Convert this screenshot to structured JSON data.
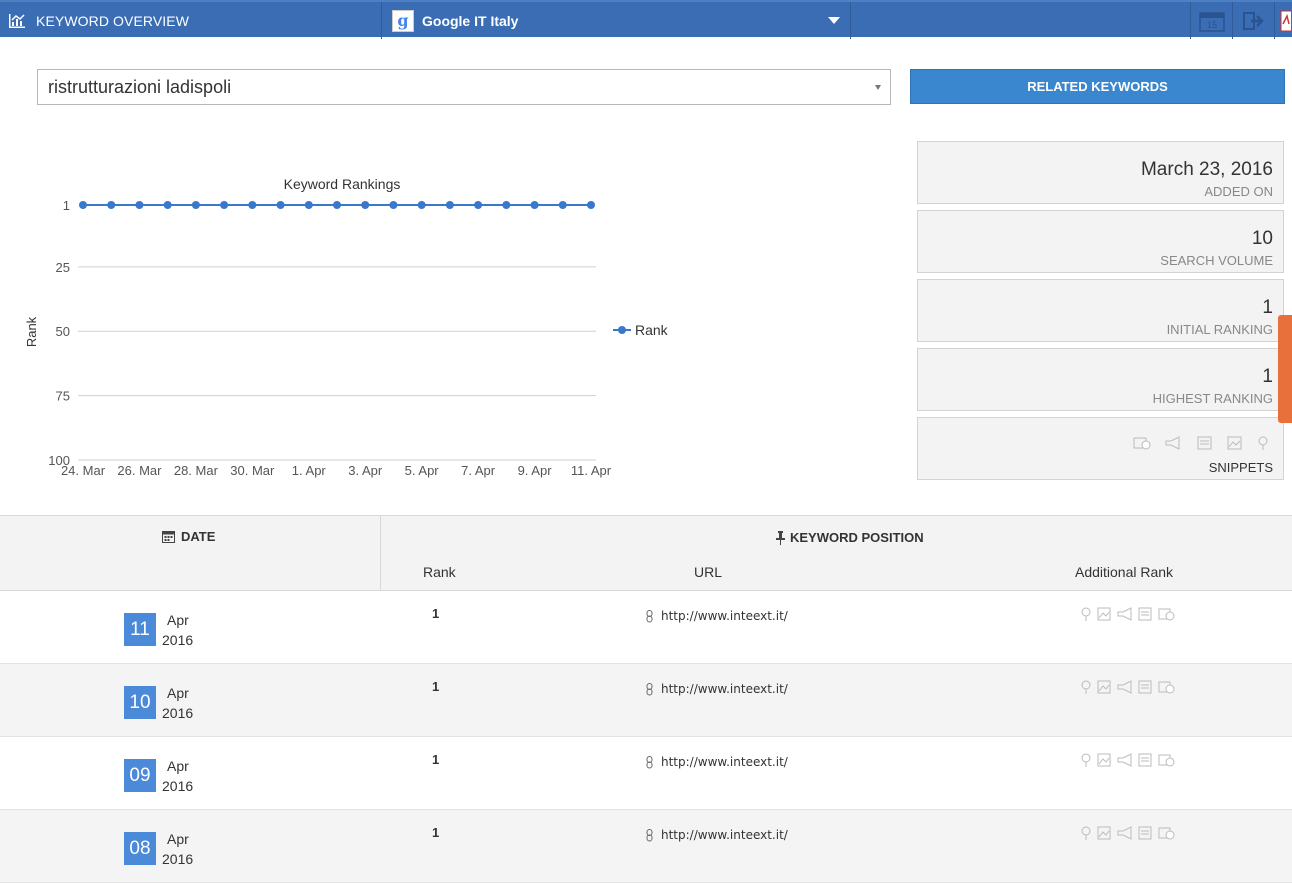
{
  "header": {
    "title": "KEYWORD OVERVIEW",
    "engine": "Google IT Italy",
    "google_letter": "g"
  },
  "search": {
    "value": "ristrutturazioni ladispoli",
    "related_button": "RELATED KEYWORDS"
  },
  "cards": [
    {
      "value": "March 23, 2016",
      "label": "ADDED ON"
    },
    {
      "value": "10",
      "label": "SEARCH VOLUME"
    },
    {
      "value": "1",
      "label": "INITIAL RANKING"
    },
    {
      "value": "1",
      "label": "HIGHEST RANKING"
    },
    {
      "label": "SNIPPETS"
    }
  ],
  "chart_data": {
    "type": "line",
    "title": "Keyword Rankings",
    "ylabel": "Rank",
    "xlabel": "",
    "y_reversed": true,
    "ylim": [
      1,
      100
    ],
    "yticks": [
      1,
      25,
      50,
      75,
      100
    ],
    "xticks": [
      "24. Mar",
      "26. Mar",
      "28. Mar",
      "30. Mar",
      "1. Apr",
      "3. Apr",
      "5. Apr",
      "7. Apr",
      "9. Apr",
      "11. Apr"
    ],
    "x": [
      "24. Mar",
      "25. Mar",
      "26. Mar",
      "27. Mar",
      "28. Mar",
      "29. Mar",
      "30. Mar",
      "31. Mar",
      "1. Apr",
      "2. Apr",
      "3. Apr",
      "4. Apr",
      "5. Apr",
      "6. Apr",
      "7. Apr",
      "8. Apr",
      "9. Apr",
      "10. Apr",
      "11. Apr"
    ],
    "series": [
      {
        "name": "Rank",
        "color": "#3a78cc",
        "values": [
          1,
          1,
          1,
          1,
          1,
          1,
          1,
          1,
          1,
          1,
          1,
          1,
          1,
          1,
          1,
          1,
          1,
          1,
          1
        ]
      }
    ],
    "grid": true,
    "legend": "right"
  },
  "table": {
    "date_header": "DATE",
    "position_header": "KEYWORD POSITION",
    "col_rank": "Rank",
    "col_url": "URL",
    "col_additional": "Additional Rank",
    "rows": [
      {
        "day": "11",
        "month": "Apr",
        "year": "2016",
        "rank": "1",
        "url": "http://www.inteext.it/"
      },
      {
        "day": "10",
        "month": "Apr",
        "year": "2016",
        "rank": "1",
        "url": "http://www.inteext.it/"
      },
      {
        "day": "09",
        "month": "Apr",
        "year": "2016",
        "rank": "1",
        "url": "http://www.inteext.it/"
      },
      {
        "day": "08",
        "month": "Apr",
        "year": "2016",
        "rank": "1",
        "url": "http://www.inteext.it/"
      }
    ]
  },
  "colors": {
    "header_bg": "#3a6db4",
    "button_bg": "#3a87cf",
    "badge_bg": "#4a8ad9",
    "help_tab": "#e8703a"
  }
}
